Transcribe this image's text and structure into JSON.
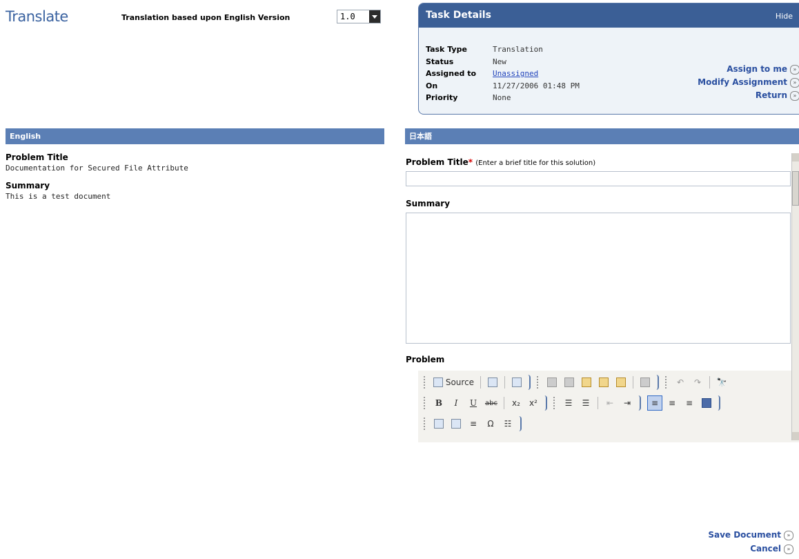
{
  "header": {
    "title": "Translate",
    "version_label": "Translation based upon English Version",
    "version_value": "1.0"
  },
  "task": {
    "title": "Task Details",
    "hide_label": "Hide",
    "rows": [
      {
        "key": "Task Type",
        "value": "Translation"
      },
      {
        "key": "Status",
        "value": "New"
      },
      {
        "key": "Assigned to",
        "value": "Unassigned"
      },
      {
        "key": "On",
        "value": "11/27/2006 01:48 PM"
      },
      {
        "key": "Priority",
        "value": "None"
      }
    ],
    "actions": {
      "assign": "Assign to me",
      "modify": "Modify Assignment",
      "return": "Return"
    }
  },
  "english": {
    "header": "English",
    "problem_title_label": "Problem Title",
    "problem_title_value": "Documentation for Secured File Attribute",
    "summary_label": "Summary",
    "summary_value": "This is a test document"
  },
  "japanese": {
    "header": "日本語",
    "problem_title_label": "Problem Title",
    "required_mark": "*",
    "problem_title_hint": "(Enter a brief title for this solution)",
    "summary_label": "Summary",
    "problem_label": "Problem"
  },
  "editor": {
    "source_label": "Source",
    "bold": "B",
    "italic": "I",
    "underline": "U",
    "strike": "abc",
    "subscript": "x₂",
    "superscript": "x²",
    "omega": "Ω"
  },
  "footer": {
    "save": "Save Document",
    "cancel": "Cancel"
  }
}
